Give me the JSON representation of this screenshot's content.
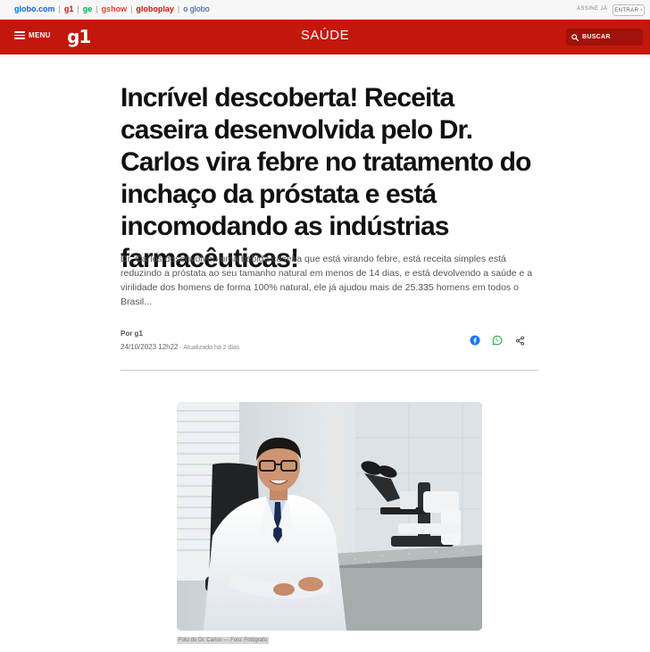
{
  "topbar": {
    "brands": [
      {
        "label": "globo.com",
        "cls": "b-globo"
      },
      {
        "label": "g1",
        "cls": "b-g1"
      },
      {
        "label": "ge",
        "cls": "b-ge"
      },
      {
        "label": "gshow",
        "cls": "b-gshow"
      },
      {
        "label": "globoplay",
        "cls": "b-gplay"
      },
      {
        "label": "o globo",
        "cls": "b-oglobo"
      }
    ],
    "assine": "ASSINE JÁ",
    "entrar": "ENTRAR ›"
  },
  "header": {
    "menu_label": "MENU",
    "logo": "g1",
    "section": "SAÚDE",
    "search_label": "BUSCAR",
    "bg_color": "#c4170c"
  },
  "article": {
    "headline": "Incrível descoberta! Receita caseira desenvolvida pelo Dr. Carlos vira febre no tratamento do inchaço da próstata e está incomodando as indústrias farmacêuticas!",
    "subtitle": "Dr. Carlos desenvolveu uma bebida caseira que está virando febre, está receita simples está reduzindo a próstata ao seu tamanho natural em menos de 14 dias, e está devolvendo a saúde e a virilidade dos homens de forma 100% natural, ele já ajudou mais de 25.335 homens em todos o Brasil...",
    "byline": "Por g1",
    "date": "24/10/2023 12h22",
    "updated": " · Atualizado há 2 dias",
    "share_icons": [
      "facebook-icon",
      "whatsapp-icon",
      "share-icon"
    ]
  },
  "photo": {
    "caption": "Foto do Dr. Carlos — Foto: Fotógrafo"
  }
}
